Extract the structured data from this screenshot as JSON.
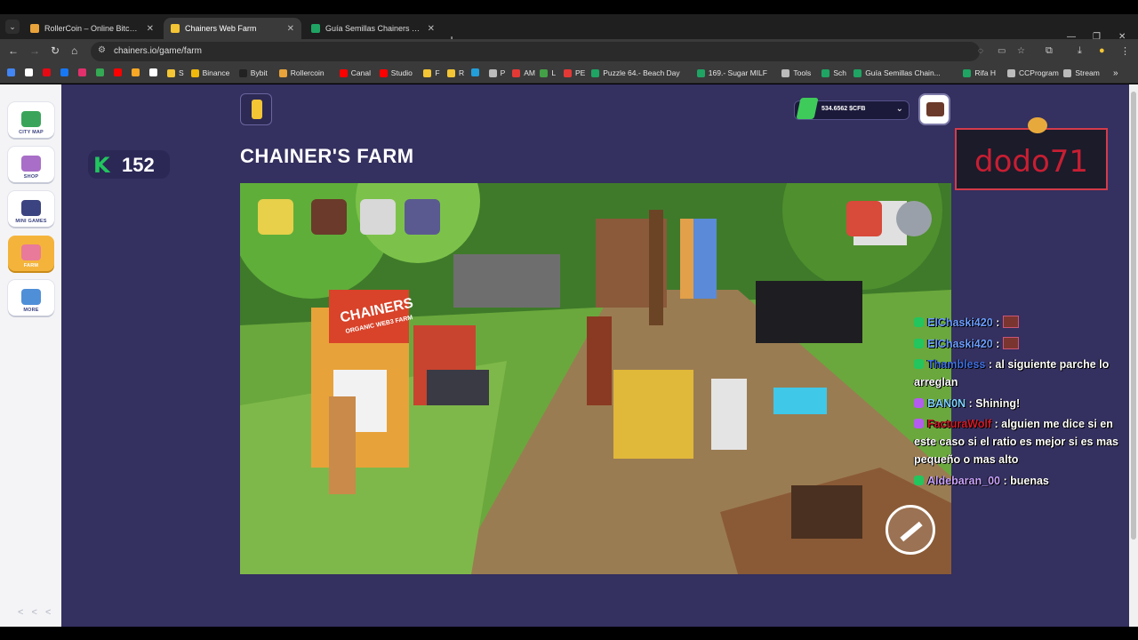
{
  "browser": {
    "tabs": [
      {
        "title": "RollerCoin – Online Bitcoin Mi",
        "active": false,
        "color": "#e8a33a"
      },
      {
        "title": "Chainers Web Farm",
        "active": true,
        "color": "#f4c534"
      },
      {
        "title": "Guía Semillas Chainers by Pier",
        "active": false,
        "color": "#1fa463"
      }
    ],
    "new_tab": "+",
    "url": "chainers.io/game/farm",
    "bookmarks": [
      {
        "label": "",
        "color": "#4285f4"
      },
      {
        "label": "",
        "color": "#ffffff"
      },
      {
        "label": "",
        "color": "#e50914"
      },
      {
        "label": "",
        "color": "#1877f2"
      },
      {
        "label": "",
        "color": "#e1306c"
      },
      {
        "label": "",
        "color": "#34a853"
      },
      {
        "label": "",
        "color": "#ff0000"
      },
      {
        "label": "",
        "color": "#f9a825"
      },
      {
        "label": "",
        "color": "#ffffff"
      },
      {
        "label": "S",
        "color": "#f4c534"
      },
      {
        "label": "Binance",
        "color": "#f0b90b"
      },
      {
        "label": "Bybit",
        "color": "#222222"
      },
      {
        "label": "Rollercoin",
        "color": "#e8a33a"
      },
      {
        "label": "Canal",
        "color": "#ff0000"
      },
      {
        "label": "Studio",
        "color": "#ff0000"
      },
      {
        "label": "F",
        "color": "#f4c534"
      },
      {
        "label": "R",
        "color": "#f4c534"
      },
      {
        "label": "",
        "color": "#229ed9"
      },
      {
        "label": "P",
        "color": "#bbbbbb"
      },
      {
        "label": "AM",
        "color": "#e53935"
      },
      {
        "label": "L",
        "color": "#43a047"
      },
      {
        "label": "PE",
        "color": "#e53935"
      },
      {
        "label": "Puzzle 64.- Beach Day",
        "color": "#1fa463"
      },
      {
        "label": "169.- Sugar MILF",
        "color": "#1fa463"
      },
      {
        "label": "Tools",
        "color": "#bbbbbb"
      },
      {
        "label": "Sch",
        "color": "#1fa463"
      },
      {
        "label": "Guía Semillas Chain...",
        "color": "#1fa463"
      },
      {
        "label": "Rifa H",
        "color": "#1fa463"
      },
      {
        "label": "CCProgram",
        "color": "#bbbbbb"
      },
      {
        "label": "Stream",
        "color": "#bbbbbb"
      }
    ]
  },
  "sidebar": {
    "items": [
      {
        "label": "CITY MAP",
        "icon": "map-pin-icon",
        "color": "#3aa55a"
      },
      {
        "label": "SHOP",
        "icon": "cow-icon",
        "color": "#a86ec8"
      },
      {
        "label": "MINI GAMES",
        "icon": "gamepad-icon",
        "color": "#3b4380"
      },
      {
        "label": "FARM",
        "icon": "cow-head-icon",
        "color": "#e97a9a"
      },
      {
        "label": "MORE",
        "icon": "grid-icon",
        "color": "#4f8fd8"
      }
    ],
    "collapse_label": "< < <"
  },
  "header": {
    "k_value": "152",
    "page_title": "CHAINER'S FARM",
    "balance": "534.6562 $CFB"
  },
  "game": {
    "sign_title": "CHAINERS",
    "sign_subtitle": "ORGANIC WEB3 FARM",
    "menu_icons": [
      "calculator-icon",
      "money-board-icon",
      "anvil-icon",
      "robot-icon"
    ],
    "right_icons": [
      "chest-icon",
      "settings-gear-icon"
    ],
    "tool_button": "hammer-icon"
  },
  "stream": {
    "streamer_name": "dodo71",
    "chat": [
      {
        "user": "ElChaski420",
        "user_color": "#6b9dff",
        "text": ":",
        "badge": "#22c55e",
        "avatar": true
      },
      {
        "user": "ElChaski420",
        "user_color": "#6b9dff",
        "text": ":",
        "badge": "#22c55e",
        "avatar": true
      },
      {
        "user": "Thambless",
        "user_color": "#3f6fe0",
        "text": ": al siguiente parche lo arreglan",
        "badge": "#22c55e",
        "avatar": false
      },
      {
        "user": "BAN0N",
        "user_color": "#7fd0ff",
        "text": ": Shining!",
        "badge": "#b45cf0",
        "avatar": false
      },
      {
        "user": "FacturaWolf",
        "user_color": "#d11a2a",
        "text": ": alguien me dice si en este caso si el ratio es mejor si es mas pequeño o mas alto",
        "badge": "#b45cf0",
        "avatar": false
      },
      {
        "user": "Aldebaran_00",
        "user_color": "#c9a3ff",
        "text": ": buenas",
        "badge": "#22c55e",
        "avatar": false
      }
    ]
  },
  "colors": {
    "page_bg": "#34305f",
    "sidebar_bg": "#f4f4f6",
    "active_item": "#f4b43b",
    "k_green": "#22c55e"
  }
}
